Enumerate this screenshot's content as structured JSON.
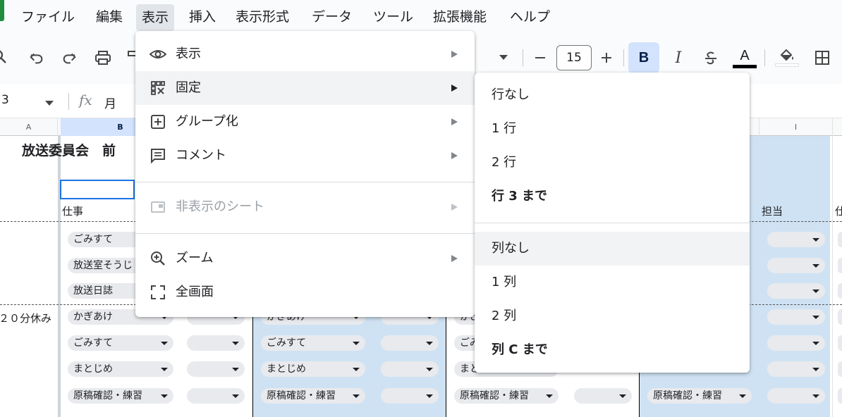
{
  "menubar": {
    "items": [
      "ファイル",
      "編集",
      "表示",
      "挿入",
      "表示形式",
      "データ",
      "ツール",
      "拡張機能",
      "ヘルプ"
    ],
    "active_item": "表示"
  },
  "toolbar": {
    "font_size": "15",
    "bold_label": "B",
    "italic_label": "I",
    "text_color_label": "A"
  },
  "formula_bar": {
    "name_box": "3",
    "fx_label": "fx",
    "formula_text": "月"
  },
  "sheet": {
    "column_headers": [
      "A",
      "B",
      "I"
    ],
    "title": "放送委員会　前",
    "header_shigoto": "仕事",
    "header_tanto": "担当",
    "header_partial": "仕",
    "row_label_break": "２０分休み",
    "chips_col_b": [
      "ごみすて",
      "放送室そうじ",
      "放送日誌",
      "かぎあけ",
      "ごみすて",
      "まとじめ",
      "原稿確認・練習"
    ],
    "chips_col_e": [
      "かぎあけ",
      "ごみすて",
      "まとじめ",
      "原稿確認・練習"
    ],
    "chips_col_g": [
      "かぎ",
      "ごみ",
      "まと",
      "原稿確認・練習"
    ],
    "chips_col_j": [
      "原稿確認・練習"
    ]
  },
  "view_menu": {
    "items": [
      {
        "label": "表示",
        "icon": "eye-icon",
        "submenu": true
      },
      {
        "label": "固定",
        "icon": "freeze-grid-icon",
        "submenu": true
      },
      {
        "label": "グループ化",
        "icon": "plus-box-icon",
        "submenu": true
      },
      {
        "label": "コメント",
        "icon": "comment-icon",
        "submenu": true
      },
      {
        "label": "非表示のシート",
        "icon": "hidden-sheet-icon",
        "submenu": true,
        "disabled": true
      },
      {
        "label": "ズーム",
        "icon": "zoom-in-icon",
        "submenu": true
      },
      {
        "label": "全画面",
        "icon": "fullscreen-icon",
        "submenu": false
      }
    ]
  },
  "freeze_menu": {
    "rows": [
      "行なし",
      "1 行",
      "2 行",
      "行 3 まで"
    ],
    "cols": [
      "列なし",
      "1 列",
      "2 列",
      "列 C まで"
    ]
  },
  "colors": {
    "accent": "#1a73e8",
    "selected_column_bg": "#cfe2f3",
    "menu_hover": "#f1f3f4"
  }
}
